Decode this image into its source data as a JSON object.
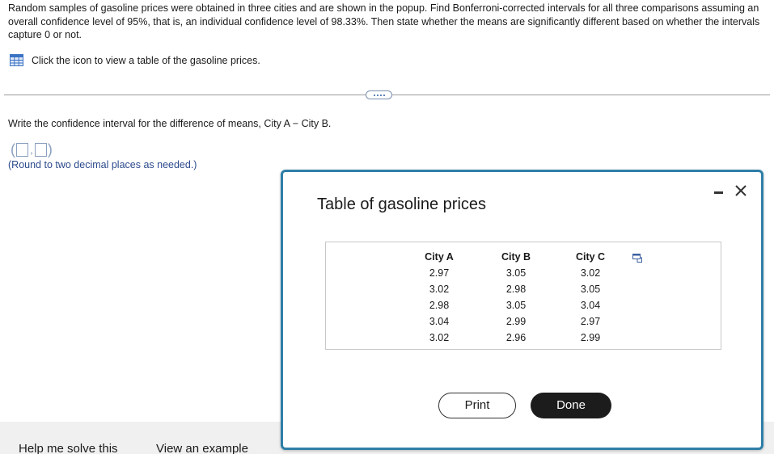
{
  "question": {
    "text": "Random samples of gasoline prices were obtained in three cities and are shown in the popup. Find Bonferroni-corrected intervals for all three comparisons assuming an overall confidence level of 95%, that is, an individual confidence level of 98.33%. Then state whether the means are significantly different based on whether the intervals capture 0 or not.",
    "icon_link_text": "Click the icon to view a table of the gasoline prices.",
    "icon_name": "table-grid-icon"
  },
  "prompt": {
    "text": "Write the confidence interval for the difference of means, City A − City B.",
    "answer_values": [
      "",
      ""
    ],
    "round_note": "(Round to two decimal places as needed.)"
  },
  "bottom_bar": {
    "help_label": "Help me solve this",
    "example_label": "View an example"
  },
  "popup": {
    "title": "Table of gasoline prices",
    "columns": [
      {
        "header": "City A",
        "values": [
          "2.97",
          "3.02",
          "2.98",
          "3.04",
          "3.02"
        ]
      },
      {
        "header": "City B",
        "values": [
          "3.05",
          "2.98",
          "3.05",
          "2.99",
          "2.96"
        ]
      },
      {
        "header": "City C",
        "values": [
          "3.02",
          "3.05",
          "3.04",
          "2.97",
          "2.99"
        ]
      }
    ],
    "print_label": "Print",
    "done_label": "Done",
    "accent_color": "#2e7fa8"
  }
}
